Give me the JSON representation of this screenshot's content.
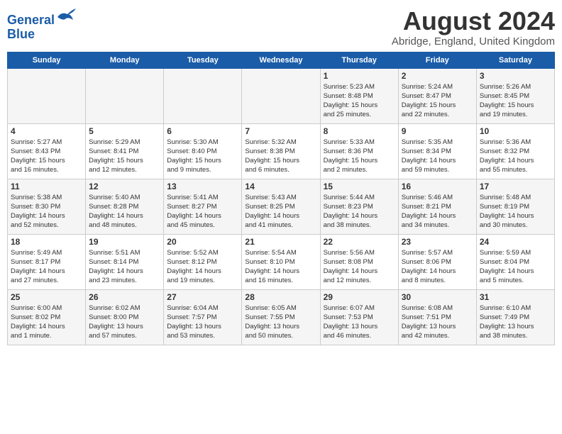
{
  "header": {
    "logo_line1": "General",
    "logo_line2": "Blue",
    "month_title": "August 2024",
    "subtitle": "Abridge, England, United Kingdom"
  },
  "weekdays": [
    "Sunday",
    "Monday",
    "Tuesday",
    "Wednesday",
    "Thursday",
    "Friday",
    "Saturday"
  ],
  "weeks": [
    [
      {
        "day": "",
        "info": ""
      },
      {
        "day": "",
        "info": ""
      },
      {
        "day": "",
        "info": ""
      },
      {
        "day": "",
        "info": ""
      },
      {
        "day": "1",
        "info": "Sunrise: 5:23 AM\nSunset: 8:48 PM\nDaylight: 15 hours\nand 25 minutes."
      },
      {
        "day": "2",
        "info": "Sunrise: 5:24 AM\nSunset: 8:47 PM\nDaylight: 15 hours\nand 22 minutes."
      },
      {
        "day": "3",
        "info": "Sunrise: 5:26 AM\nSunset: 8:45 PM\nDaylight: 15 hours\nand 19 minutes."
      }
    ],
    [
      {
        "day": "4",
        "info": "Sunrise: 5:27 AM\nSunset: 8:43 PM\nDaylight: 15 hours\nand 16 minutes."
      },
      {
        "day": "5",
        "info": "Sunrise: 5:29 AM\nSunset: 8:41 PM\nDaylight: 15 hours\nand 12 minutes."
      },
      {
        "day": "6",
        "info": "Sunrise: 5:30 AM\nSunset: 8:40 PM\nDaylight: 15 hours\nand 9 minutes."
      },
      {
        "day": "7",
        "info": "Sunrise: 5:32 AM\nSunset: 8:38 PM\nDaylight: 15 hours\nand 6 minutes."
      },
      {
        "day": "8",
        "info": "Sunrise: 5:33 AM\nSunset: 8:36 PM\nDaylight: 15 hours\nand 2 minutes."
      },
      {
        "day": "9",
        "info": "Sunrise: 5:35 AM\nSunset: 8:34 PM\nDaylight: 14 hours\nand 59 minutes."
      },
      {
        "day": "10",
        "info": "Sunrise: 5:36 AM\nSunset: 8:32 PM\nDaylight: 14 hours\nand 55 minutes."
      }
    ],
    [
      {
        "day": "11",
        "info": "Sunrise: 5:38 AM\nSunset: 8:30 PM\nDaylight: 14 hours\nand 52 minutes."
      },
      {
        "day": "12",
        "info": "Sunrise: 5:40 AM\nSunset: 8:28 PM\nDaylight: 14 hours\nand 48 minutes."
      },
      {
        "day": "13",
        "info": "Sunrise: 5:41 AM\nSunset: 8:27 PM\nDaylight: 14 hours\nand 45 minutes."
      },
      {
        "day": "14",
        "info": "Sunrise: 5:43 AM\nSunset: 8:25 PM\nDaylight: 14 hours\nand 41 minutes."
      },
      {
        "day": "15",
        "info": "Sunrise: 5:44 AM\nSunset: 8:23 PM\nDaylight: 14 hours\nand 38 minutes."
      },
      {
        "day": "16",
        "info": "Sunrise: 5:46 AM\nSunset: 8:21 PM\nDaylight: 14 hours\nand 34 minutes."
      },
      {
        "day": "17",
        "info": "Sunrise: 5:48 AM\nSunset: 8:19 PM\nDaylight: 14 hours\nand 30 minutes."
      }
    ],
    [
      {
        "day": "18",
        "info": "Sunrise: 5:49 AM\nSunset: 8:17 PM\nDaylight: 14 hours\nand 27 minutes."
      },
      {
        "day": "19",
        "info": "Sunrise: 5:51 AM\nSunset: 8:14 PM\nDaylight: 14 hours\nand 23 minutes."
      },
      {
        "day": "20",
        "info": "Sunrise: 5:52 AM\nSunset: 8:12 PM\nDaylight: 14 hours\nand 19 minutes."
      },
      {
        "day": "21",
        "info": "Sunrise: 5:54 AM\nSunset: 8:10 PM\nDaylight: 14 hours\nand 16 minutes."
      },
      {
        "day": "22",
        "info": "Sunrise: 5:56 AM\nSunset: 8:08 PM\nDaylight: 14 hours\nand 12 minutes."
      },
      {
        "day": "23",
        "info": "Sunrise: 5:57 AM\nSunset: 8:06 PM\nDaylight: 14 hours\nand 8 minutes."
      },
      {
        "day": "24",
        "info": "Sunrise: 5:59 AM\nSunset: 8:04 PM\nDaylight: 14 hours\nand 5 minutes."
      }
    ],
    [
      {
        "day": "25",
        "info": "Sunrise: 6:00 AM\nSunset: 8:02 PM\nDaylight: 14 hours\nand 1 minute."
      },
      {
        "day": "26",
        "info": "Sunrise: 6:02 AM\nSunset: 8:00 PM\nDaylight: 13 hours\nand 57 minutes."
      },
      {
        "day": "27",
        "info": "Sunrise: 6:04 AM\nSunset: 7:57 PM\nDaylight: 13 hours\nand 53 minutes."
      },
      {
        "day": "28",
        "info": "Sunrise: 6:05 AM\nSunset: 7:55 PM\nDaylight: 13 hours\nand 50 minutes."
      },
      {
        "day": "29",
        "info": "Sunrise: 6:07 AM\nSunset: 7:53 PM\nDaylight: 13 hours\nand 46 minutes."
      },
      {
        "day": "30",
        "info": "Sunrise: 6:08 AM\nSunset: 7:51 PM\nDaylight: 13 hours\nand 42 minutes."
      },
      {
        "day": "31",
        "info": "Sunrise: 6:10 AM\nSunset: 7:49 PM\nDaylight: 13 hours\nand 38 minutes."
      }
    ]
  ]
}
